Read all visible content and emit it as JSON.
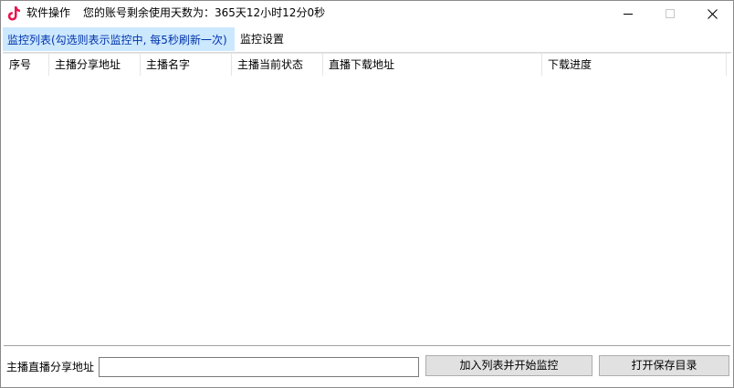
{
  "window": {
    "menu_label": "软件操作",
    "title": "您的账号剩余使用天数为：365天12小时12分0秒"
  },
  "window_controls": {
    "minimize": "—",
    "maximize": "☐",
    "close": "✕"
  },
  "tabs": [
    {
      "label": "监控列表(勾选则表示监控中, 每5秒刷新一次)",
      "active": true
    },
    {
      "label": "监控设置",
      "active": false
    }
  ],
  "table": {
    "columns": [
      "序号",
      "主播分享地址",
      "主播名字",
      "主播当前状态",
      "直播下载地址",
      "下载进度"
    ],
    "rows": []
  },
  "bottom": {
    "label": "主播直播分享地址",
    "input_value": "",
    "start_button": "加入列表并开始监控",
    "open_button": "打开保存目录"
  },
  "colors": {
    "active_tab_bg": "#cce8ff",
    "active_tab_text": "#0033aa",
    "button_bg": "#e1e1e1",
    "app_icon_pink": "#e6174f"
  }
}
